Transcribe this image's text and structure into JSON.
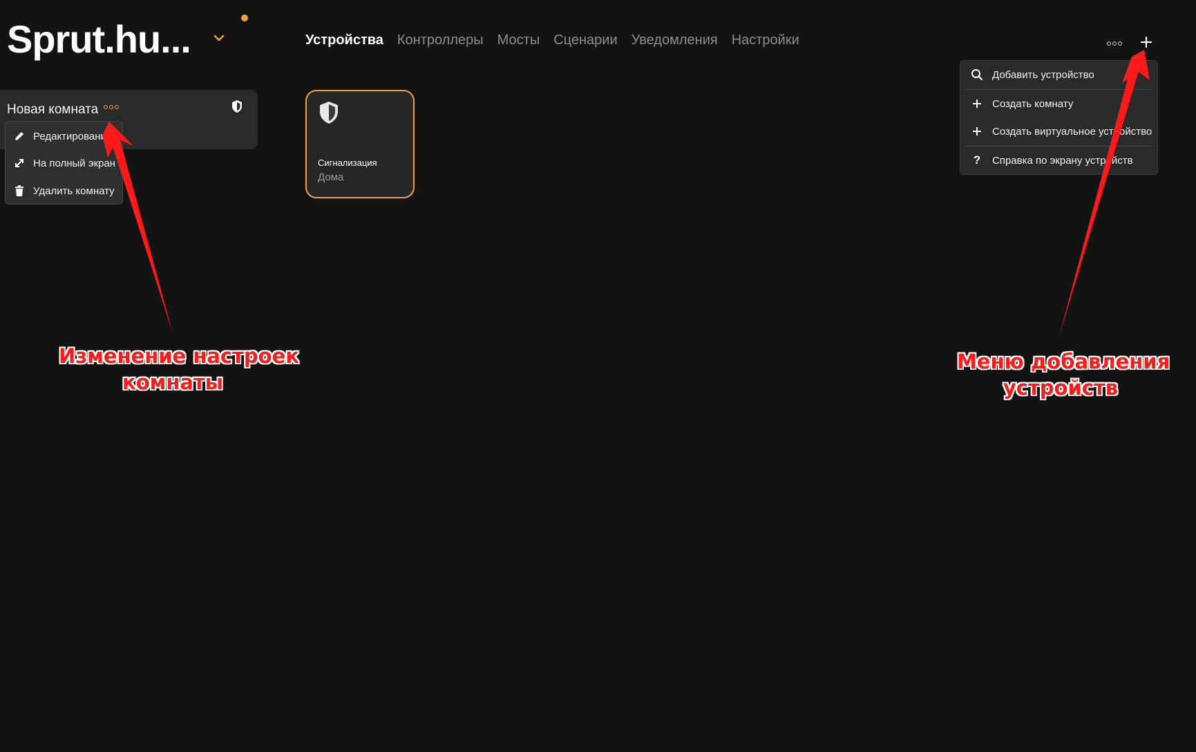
{
  "header": {
    "brand": "Sprut.hu...",
    "nav": [
      {
        "label": "Устройства",
        "active": true
      },
      {
        "label": "Контроллеры",
        "active": false
      },
      {
        "label": "Мосты",
        "active": false
      },
      {
        "label": "Сценарии",
        "active": false
      },
      {
        "label": "Уведомления",
        "active": false
      },
      {
        "label": "Настройки",
        "active": false
      }
    ]
  },
  "add_menu": {
    "items": [
      {
        "label": "Добавить устройство",
        "icon": "search-icon"
      },
      {
        "label": "Создать комнату",
        "icon": "plus-icon"
      },
      {
        "label": "Создать виртуальное устройство",
        "icon": "plus-icon"
      },
      {
        "label": "Справка по экрану устройств",
        "icon": "question-icon"
      }
    ]
  },
  "room": {
    "title": "Новая комната",
    "context_menu": [
      {
        "label": "Редактирование",
        "icon": "pencil-icon"
      },
      {
        "label": "На полный экран",
        "icon": "expand-icon"
      },
      {
        "label": "Удалить комнату",
        "icon": "trash-icon"
      }
    ]
  },
  "device_tile": {
    "name": "Сигнализация",
    "state": "Дома",
    "icon": "shield-icon"
  },
  "annotations": {
    "left": [
      "Изменение настроек",
      "комнаты"
    ],
    "right": [
      "Меню добавления",
      "устройств"
    ]
  },
  "colors": {
    "background": "#131313",
    "accent": "#f2a23a",
    "annotation": "#ff1a1a"
  }
}
